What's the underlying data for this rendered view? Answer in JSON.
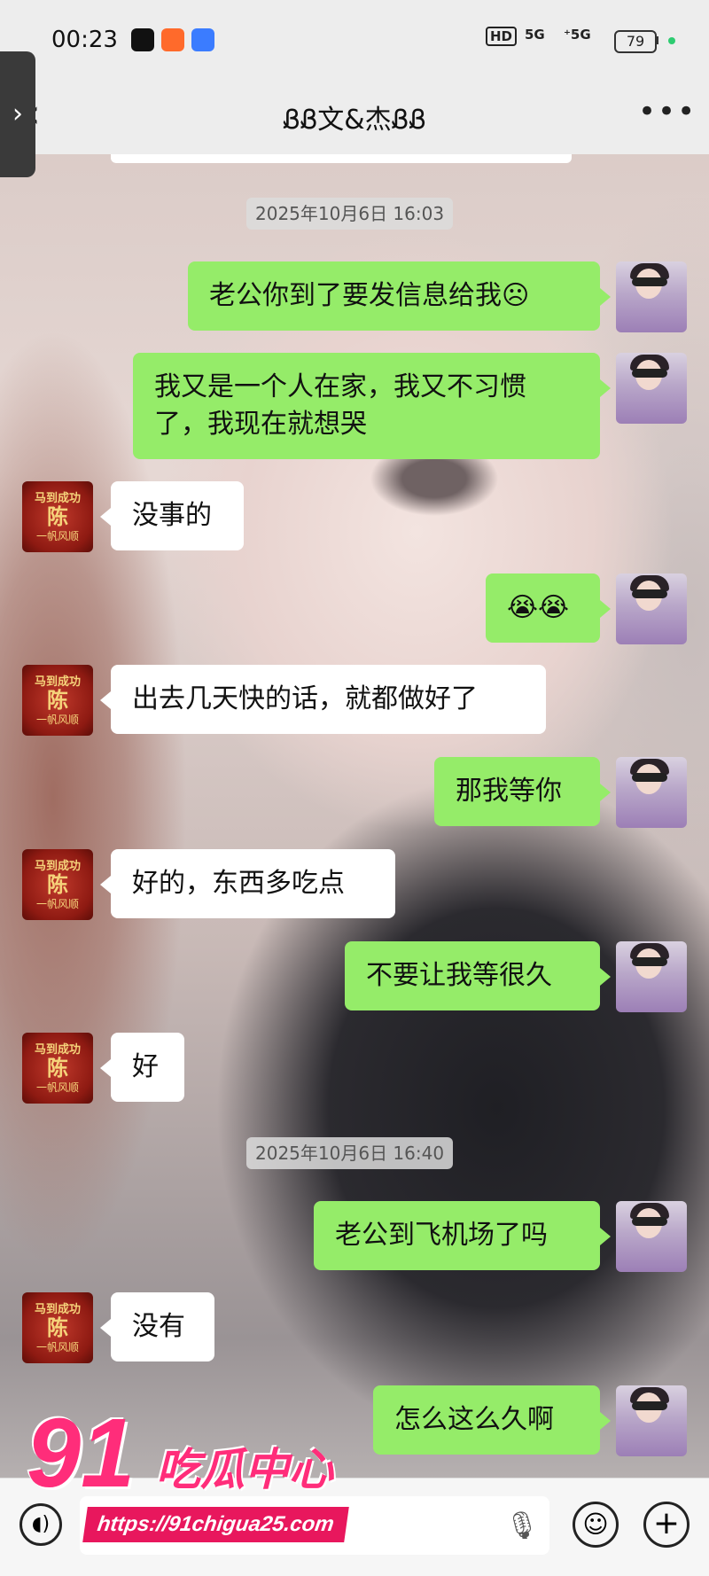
{
  "status_bar": {
    "time": "00:23",
    "battery": "79",
    "signal_1": "5G",
    "signal_2": "⁺5G",
    "hd_badge": "HD"
  },
  "header": {
    "title": "ᏰᏰ文&杰ᏰᏰ"
  },
  "timestamps": [
    "2025年10月6日 16:03",
    "2025年10月6日 16:40"
  ],
  "messages": [
    {
      "from": "me",
      "text": "老公你到了要发信息给我☹"
    },
    {
      "from": "me",
      "text": "我又是一个人在家，我又不习惯了，我现在就想哭"
    },
    {
      "from": "them",
      "text": "没事的"
    },
    {
      "from": "me",
      "text": "😭😭"
    },
    {
      "from": "them",
      "text": "出去几天快的话，就都做好了"
    },
    {
      "from": "me",
      "text": "那我等你"
    },
    {
      "from": "them",
      "text": "好的，东西多吃点"
    },
    {
      "from": "me",
      "text": "不要让我等很久"
    },
    {
      "from": "them",
      "text": "好"
    },
    {
      "from": "me",
      "text": "老公到飞机场了吗"
    },
    {
      "from": "them",
      "text": "没有"
    },
    {
      "from": "me",
      "text": "怎么这么久啊"
    }
  ],
  "them_avatar": {
    "line1": "马到成功",
    "line2": "陈",
    "line3": "一帆风顺"
  },
  "watermark": {
    "logo": "91",
    "text": "吃瓜中心",
    "url": "https://91chigua25.com"
  },
  "icons": {
    "back": "chevron-left-icon",
    "more": "more-dots-icon",
    "voice": "voice-icon",
    "mic": "microphone-icon",
    "emoji": "emoji-icon",
    "plus": "plus-icon"
  },
  "colors": {
    "my_bubble": "#95ec69",
    "their_bubble": "#ffffff",
    "watermark": "#ff2d7a"
  }
}
